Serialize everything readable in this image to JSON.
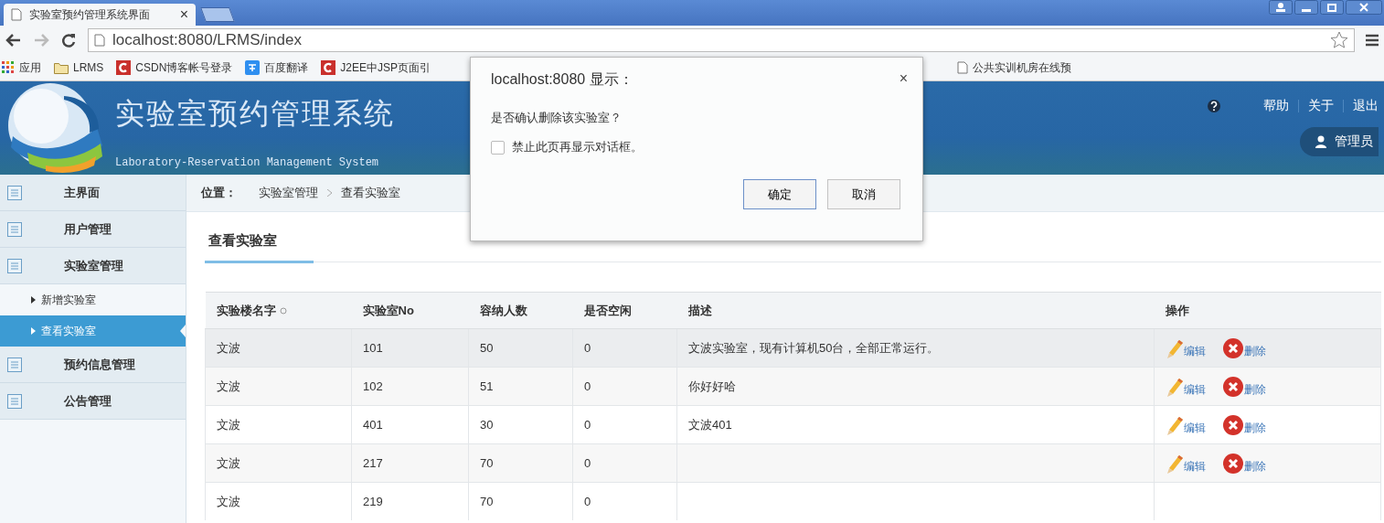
{
  "browser": {
    "tab_title": "实验室预约管理系统界面",
    "tab_close": "×",
    "url": "localhost:8080/LRMS/index",
    "bookmarks": [
      {
        "kind": "apps",
        "label": "应用"
      },
      {
        "kind": "folder",
        "label": "LRMS"
      },
      {
        "kind": "csdn",
        "label": "CSDN博客帐号登录"
      },
      {
        "kind": "translate",
        "label": "百度翻译"
      },
      {
        "kind": "csdn",
        "label": "J2EE中JSP页面引"
      },
      {
        "kind": "page",
        "label": "公共实训机房在线预"
      }
    ]
  },
  "header": {
    "title": "实验室预约管理系统",
    "subtitle": "Laboratory-Reservation Management System",
    "links": [
      "帮助",
      "关于",
      "退出"
    ],
    "user": "管理员"
  },
  "sidebar": {
    "items": [
      {
        "label": "主界面",
        "selected": false
      },
      {
        "label": "用户管理",
        "selected": false
      },
      {
        "label": "实验室管理",
        "selected": false,
        "children": [
          {
            "label": "新增实验室",
            "selected": false
          },
          {
            "label": "查看实验室",
            "selected": true
          }
        ]
      },
      {
        "label": "预约信息管理",
        "selected": false
      },
      {
        "label": "公告管理",
        "selected": false
      }
    ]
  },
  "breadcrumb": {
    "label": "位置：",
    "path": [
      "实验室管理",
      "查看实验室"
    ]
  },
  "section_title": "查看实验室",
  "table": {
    "columns": [
      {
        "label": "实验楼名字",
        "sortable": true
      },
      {
        "label": "实验室No",
        "sortable": false
      },
      {
        "label": "容纳人数",
        "sortable": false
      },
      {
        "label": "是否空闲",
        "sortable": false
      },
      {
        "label": "描述",
        "sortable": false
      },
      {
        "label": "操作",
        "sortable": false
      }
    ],
    "rows": [
      {
        "highlighted": true,
        "cells": [
          "文波",
          "101",
          "50",
          "0",
          "文波实验室，现有计算机50台，全部正常运行。"
        ],
        "actions": [
          "编辑",
          "删除"
        ]
      },
      {
        "highlighted": false,
        "cells": [
          "文波",
          "102",
          "51",
          "0",
          "你好好哈"
        ],
        "actions": [
          "编辑",
          "删除"
        ]
      },
      {
        "highlighted": false,
        "cells": [
          "文波",
          "401",
          "30",
          "0",
          "文波401"
        ],
        "actions": [
          "编辑",
          "删除"
        ]
      },
      {
        "highlighted": false,
        "cells": [
          "文波",
          "217",
          "70",
          "0"
        ],
        "actions": [
          "编辑",
          "删除"
        ]
      },
      {
        "highlighted": false,
        "cells": [
          "文波",
          "219",
          "70",
          "0"
        ]
      }
    ]
  },
  "dialog": {
    "title": "localhost:8080 显示：",
    "close": "×",
    "message": "是否确认删除该实验室？",
    "checkbox": {
      "label": "禁止此页再显示对话框。",
      "checked": false
    },
    "buttons": [
      "确定",
      "取消"
    ]
  }
}
